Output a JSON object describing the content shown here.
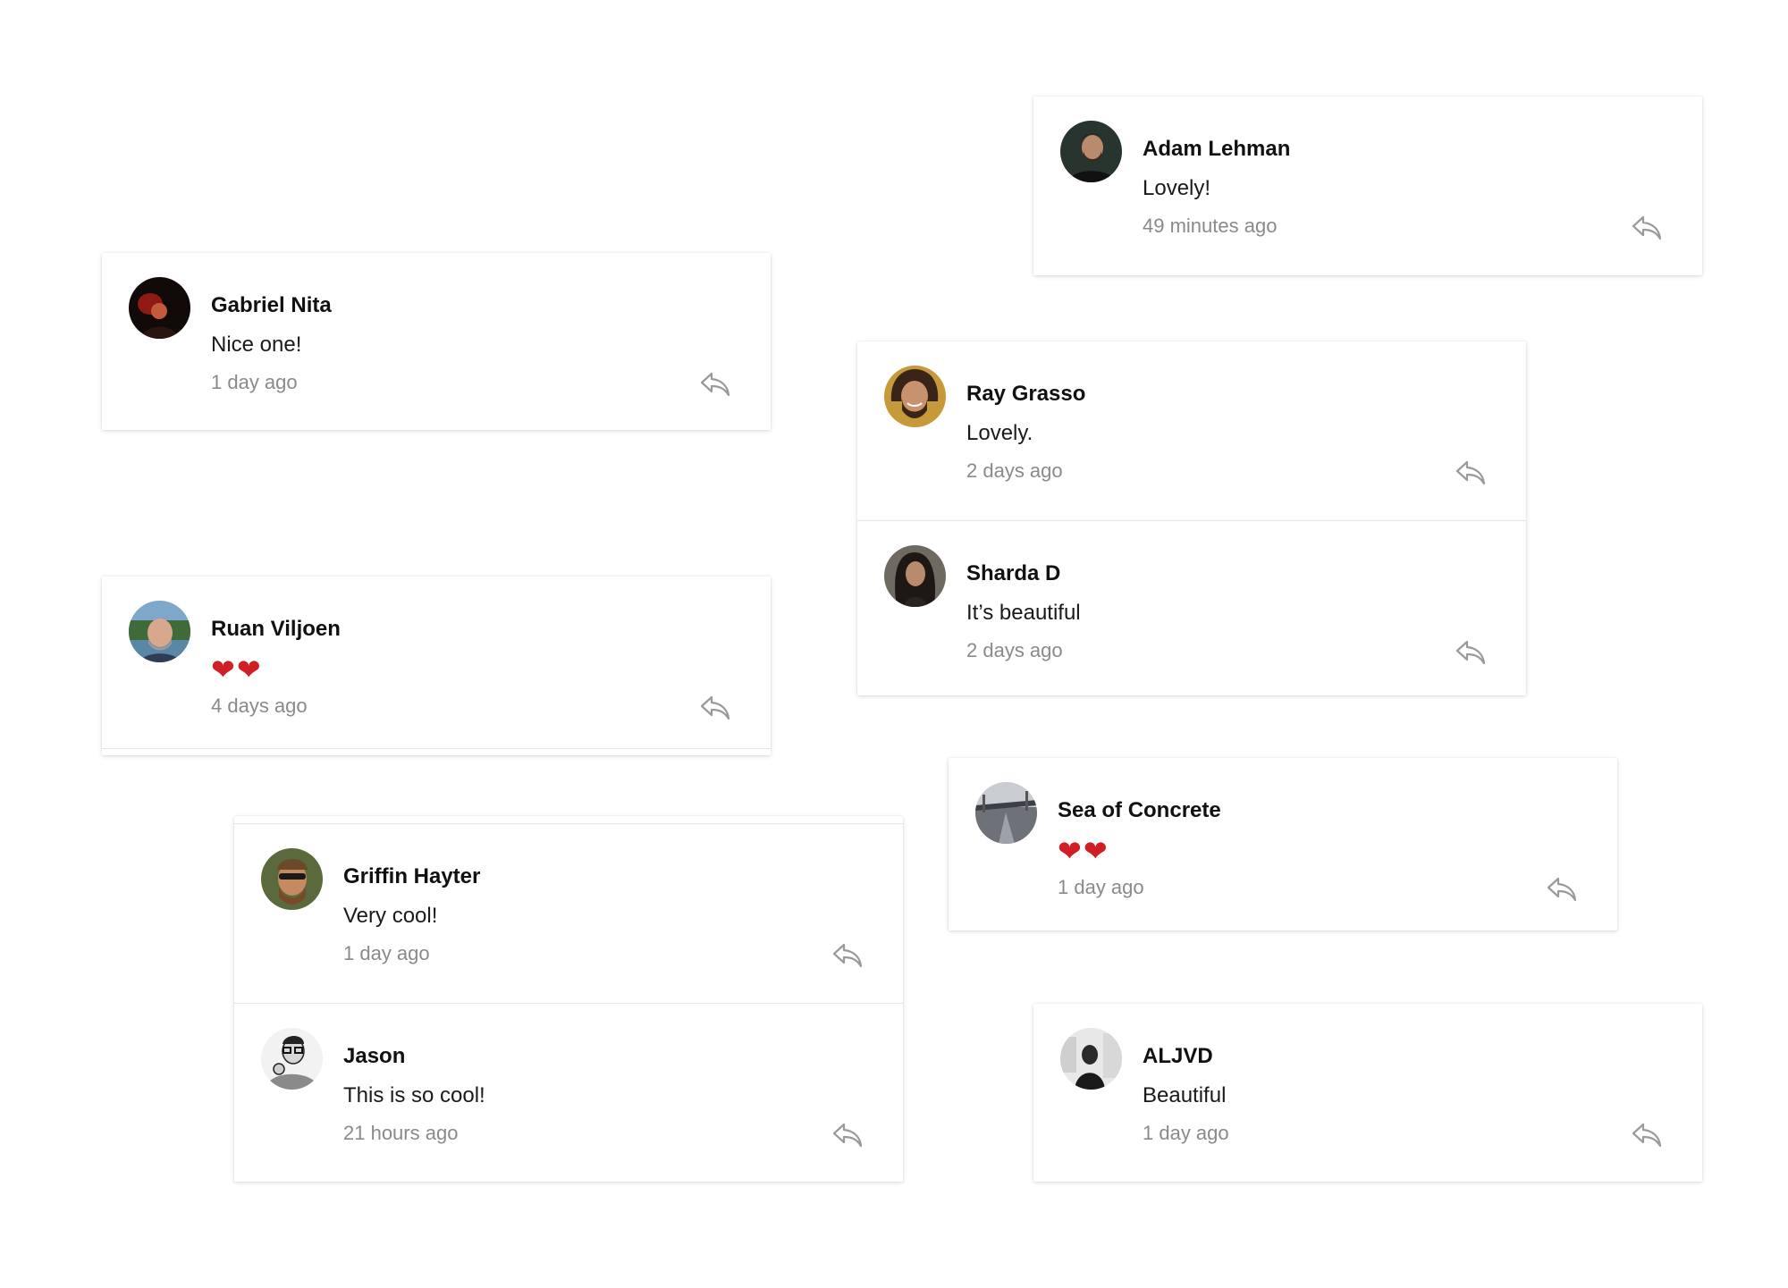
{
  "colors": {
    "name": "#111111",
    "meta": "#8a8a8a",
    "heart": "#d01f25",
    "reply_icon": "#999999"
  },
  "comments": {
    "adam": {
      "author": "Adam Lehman",
      "text": "Lovely!",
      "time": "49 minutes ago",
      "reply_icon": "reply-arrow-icon"
    },
    "gabriel": {
      "author": "Gabriel Nita",
      "text": "Nice one!",
      "time": "1 day ago",
      "reply_icon": "reply-arrow-icon"
    },
    "ray": {
      "author": "Ray Grasso",
      "text": "Lovely.",
      "time": "2 days ago",
      "reply_icon": "reply-arrow-icon"
    },
    "sharda": {
      "author": "Sharda D",
      "text": "It’s beautiful",
      "time": "2 days ago",
      "reply_icon": "reply-arrow-icon"
    },
    "ruan": {
      "author": "Ruan Viljoen",
      "text": "❤❤",
      "time": "4 days ago",
      "reply_icon": "reply-arrow-icon"
    },
    "sea": {
      "author": "Sea of Concrete",
      "text": "❤❤",
      "time": "1 day ago",
      "reply_icon": "reply-arrow-icon"
    },
    "griffin": {
      "author": "Griffin Hayter",
      "text": "Very cool!",
      "time": "1 day ago",
      "reply_icon": "reply-arrow-icon"
    },
    "jason": {
      "author": "Jason",
      "text": "This is so cool!",
      "time": "21 hours ago",
      "reply_icon": "reply-arrow-icon"
    },
    "aljvd": {
      "author": "ALJVD",
      "text": "Beautiful",
      "time": "1 day ago",
      "reply_icon": "reply-arrow-icon"
    }
  }
}
